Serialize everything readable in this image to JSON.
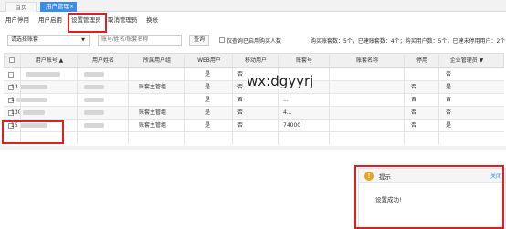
{
  "tabs": {
    "home": "首页",
    "active": "用户管理",
    "close_glyph": "×"
  },
  "menu": [
    "用户停用",
    "用户启用",
    "设置管理员",
    "取消管理员",
    "换帐"
  ],
  "filters": {
    "select_value": "请选择账套",
    "search_placeholder": "账号/姓名/账套名称",
    "query_button": "查询",
    "checkbox_label": "仅查询已启用购买人数",
    "summary": "购买账套数：5个，已建账套数：4个；购买用户数：5个，已建未停用用户：2个"
  },
  "table": {
    "headers": [
      "用户账号 ▲",
      "用户姓名",
      "所属用户组",
      "WEB用户",
      "移动用户",
      "账套号",
      "账套名称",
      "停用",
      "企业管理员 ▼"
    ],
    "rows": [
      {
        "account": "",
        "name": "",
        "group": "",
        "web": "是",
        "mobile": "否",
        "setno": "",
        "setname": "",
        "disabled": "",
        "admin": "否"
      },
      {
        "account": "13",
        "name": "",
        "group": "账套主管组",
        "web": "是",
        "mobile": "否",
        "setno": "...",
        "setname": "",
        "disabled": "否",
        "admin": "是"
      },
      {
        "account": "1",
        "name": "",
        "group": "",
        "web": "是",
        "mobile": "否",
        "setno": "...",
        "setname": "",
        "disabled": "否",
        "admin": "否"
      },
      {
        "account": "130",
        "name": "",
        "group": "账套主管组",
        "web": "是",
        "mobile": "否",
        "setno": "4...",
        "setname": "",
        "disabled": "否",
        "admin": "否"
      },
      {
        "account": "15",
        "name": "",
        "group": "账套主管组",
        "web": "是",
        "mobile": "否",
        "setno": "74000",
        "setname": "",
        "disabled": "否",
        "admin": "是"
      }
    ]
  },
  "watermark": "wx:dgyyrj",
  "notice": {
    "icon": "!",
    "title": "提示",
    "close": "关闭",
    "message": "设置成功!"
  },
  "colors": {
    "accent": "#3a8ee6",
    "highlight": "#e02020",
    "warning": "#f0a020"
  }
}
